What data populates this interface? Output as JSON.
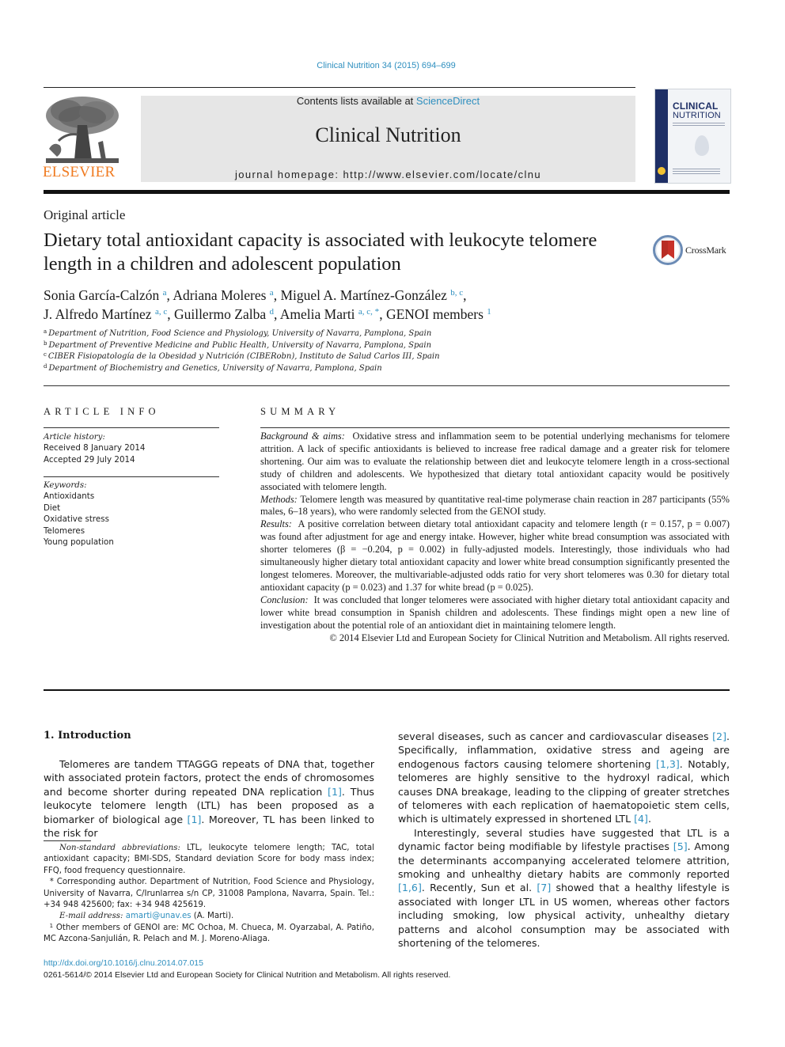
{
  "header": {
    "citation": "Clinical Nutrition 34 (2015) 694–699",
    "publisher_logo_text": "ELSEVIER",
    "contents_prefix": "Contents lists available at ",
    "contents_link": "ScienceDirect",
    "journal_name": "Clinical Nutrition",
    "homepage": "journal homepage: http://www.elsevier.com/locate/clnu",
    "cover": {
      "title_line1": "CLINICAL",
      "title_line2": "NUTRITION"
    },
    "colors": {
      "link": "#2e8fbf",
      "elsevier_orange": "#f07b21",
      "cover_blue": "#1e2f66",
      "banner_gray": "#e6e6e6"
    }
  },
  "article": {
    "type": "Original article",
    "title": "Dietary total antioxidant capacity is associated with leukocyte telomere length in a children and adolescent population",
    "crossmark_label": "CrossMark",
    "authors": [
      {
        "name": "Sonia García-Calzón",
        "aff": "a",
        "sep": ", "
      },
      {
        "name": "Adriana Moleres",
        "aff": "a",
        "sep": ", "
      },
      {
        "name": "Miguel A. Martínez-González",
        "aff": "b, c",
        "sep": ","
      },
      {
        "name": "J. Alfredo Martínez",
        "aff": "a, c",
        "sep": ", "
      },
      {
        "name": "Guillermo Zalba",
        "aff": "d",
        "sep": ", "
      },
      {
        "name": "Amelia Marti",
        "aff": "a, c, *",
        "sep": ", "
      },
      {
        "name": "GENOI members",
        "aff": "1",
        "sep": ""
      }
    ],
    "affiliations": [
      {
        "key": "a",
        "text": "Department of Nutrition, Food Science and Physiology, University of Navarra, Pamplona, Spain"
      },
      {
        "key": "b",
        "text": "Department of Preventive Medicine and Public Health, University of Navarra, Pamplona, Spain"
      },
      {
        "key": "c",
        "text": "CIBER Fisiopatología de la Obesidad y Nutrición (CIBERobn), Instituto de Salud Carlos III, Spain"
      },
      {
        "key": "d",
        "text": "Department of Biochemistry and Genetics, University of Navarra, Pamplona, Spain"
      }
    ]
  },
  "article_info": {
    "heading": "ARTICLE INFO",
    "history_label": "Article history:",
    "received": "Received 8 January 2014",
    "accepted": "Accepted 29 July 2014",
    "keywords_label": "Keywords:",
    "keywords": [
      "Antioxidants",
      "Diet",
      "Oxidative stress",
      "Telomeres",
      "Young population"
    ]
  },
  "summary": {
    "heading": "SUMMARY",
    "background_label": "Background & aims:",
    "background": "Oxidative stress and inflammation seem to be potential underlying mechanisms for telomere attrition. A lack of specific antioxidants is believed to increase free radical damage and a greater risk for telomere shortening. Our aim was to evaluate the relationship between diet and leukocyte telomere length in a cross-sectional study of children and adolescents. We hypothesized that dietary total antioxidant capacity would be positively associated with telomere length.",
    "methods_label": "Methods:",
    "methods": "Telomere length was measured by quantitative real-time polymerase chain reaction in 287 participants (55% males, 6–18 years), who were randomly selected from the GENOI study.",
    "results_label": "Results:",
    "results": "A positive correlation between dietary total antioxidant capacity and telomere length (r = 0.157, p = 0.007) was found after adjustment for age and energy intake. However, higher white bread consumption was associated with shorter telomeres (β = −0.204, p = 0.002) in fully-adjusted models. Interestingly, those individuals who had simultaneously higher dietary total antioxidant capacity and lower white bread consumption significantly presented the longest telomeres. Moreover, the multivariable-adjusted odds ratio for very short telomeres was 0.30 for dietary total antioxidant capacity (p = 0.023) and 1.37 for white bread (p = 0.025).",
    "conclusion_label": "Conclusion:",
    "conclusion": "It was concluded that longer telomeres were associated with higher dietary total antioxidant capacity and lower white bread consumption in Spanish children and adolescents. These findings might open a new line of investigation about the potential role of an antioxidant diet in maintaining telomere length.",
    "copyright": "© 2014 Elsevier Ltd and European Society for Clinical Nutrition and Metabolism. All rights reserved."
  },
  "introduction": {
    "heading": "1.  Introduction",
    "left_paragraph": [
      {
        "t": "Telomeres are tandem TTAGGG repeats of DNA that, together with associated protein factors, protect the ends of chromosomes and become shorter during repeated DNA replication "
      },
      {
        "ref": "[1]"
      },
      {
        "t": ". Thus leukocyte telomere length (LTL) has been proposed as a biomarker of biological age "
      },
      {
        "ref": "[1]"
      },
      {
        "t": ". Moreover, TL has been linked to the risk for"
      }
    ],
    "right_paragraph1": [
      {
        "t": "several diseases, such as cancer and cardiovascular diseases "
      },
      {
        "ref": "[2]"
      },
      {
        "t": ". Specifically, inflammation, oxidative stress and ageing are endogenous factors causing telomere shortening "
      },
      {
        "ref": "[1,3]"
      },
      {
        "t": ". Notably, telomeres are highly sensitive to the hydroxyl radical, which causes DNA breakage, leading to the clipping of greater stretches of telomeres with each replication of haematopoietic stem cells, which is ultimately expressed in shortened LTL "
      },
      {
        "ref": "[4]"
      },
      {
        "t": "."
      }
    ],
    "right_paragraph2": [
      {
        "t": "Interestingly, several studies have suggested that LTL is a dynamic factor being modifiable by lifestyle practises "
      },
      {
        "ref": "[5]"
      },
      {
        "t": ". Among the determinants accompanying accelerated telomere attrition, smoking and unhealthy dietary habits are commonly reported "
      },
      {
        "ref": "[1,6]"
      },
      {
        "t": ". Recently, Sun et al. "
      },
      {
        "ref": "[7]"
      },
      {
        "t": " showed that a healthy lifestyle is associated with longer LTL in US women, whereas other factors including smoking, low physical activity, unhealthy dietary patterns and alcohol consumption may be associated with shortening of the telomeres."
      }
    ]
  },
  "footnotes": {
    "abbrev_label": "Non-standard abbreviations:",
    "abbrev_text": " LTL, leukocyte telomere length; TAC, total antioxidant capacity; BMI-SDS, Standard deviation Score for body mass index; FFQ, food frequency questionnaire.",
    "corresponding_mark": "*",
    "corresponding_text": " Corresponding author. Department of Nutrition, Food Science and Physiology, University of Navarra, C/Irunlarrea s/n CP, 31008 Pamplona, Navarra, Spain. Tel.: +34 948 425600; fax: +34 948 425619.",
    "email_label": "E-mail address:",
    "email": "amarti@unav.es",
    "email_suffix": " (A. Marti).",
    "members_mark": "1",
    "members_text": " Other members of GENOI are: MC Ochoa, M. Chueca, M. Oyarzabal, A. Patiño, MC Azcona-Sanjulián, R. Pelach and M. J. Moreno-Aliaga."
  },
  "footer": {
    "doi": "http://dx.doi.org/10.1016/j.clnu.2014.07.015",
    "issn": "0261-5614/© 2014 Elsevier Ltd and European Society for Clinical Nutrition and Metabolism. All rights reserved."
  }
}
